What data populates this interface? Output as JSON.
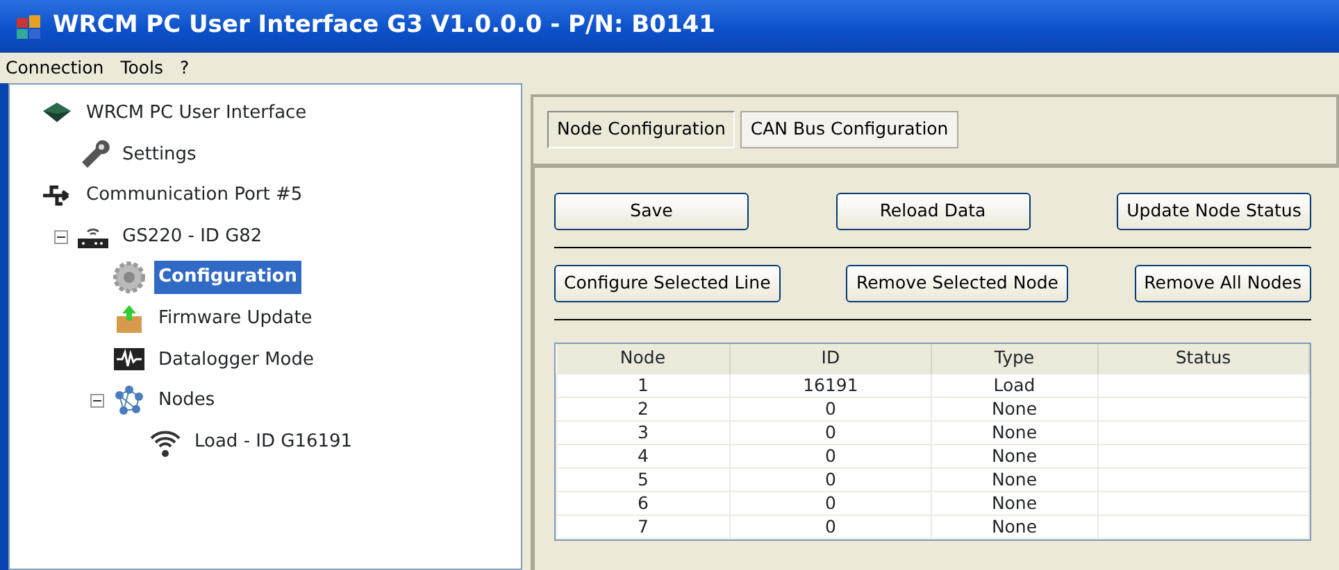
{
  "window": {
    "title": "WRCM PC User Interface G3 V1.0.0.0 - P/N: B0141"
  },
  "menu": [
    "Connection",
    "Tools",
    "?"
  ],
  "tree": [
    {
      "label": "WRCM PC User Interface",
      "kind": "app",
      "selected": false,
      "children": [
        {
          "label": "Settings",
          "kind": "settings",
          "selected": false
        }
      ]
    },
    {
      "label": "Communication Port #5",
      "kind": "port",
      "selected": false,
      "children": [
        {
          "label": "GS220 - ID G82",
          "kind": "device",
          "selected": false,
          "expanded": true,
          "children": [
            {
              "label": "Configuration",
              "kind": "config",
              "selected": true
            },
            {
              "label": "Firmware Update",
              "kind": "firmware",
              "selected": false
            },
            {
              "label": "Datalogger Mode",
              "kind": "datalogger",
              "selected": false
            },
            {
              "label": "Nodes",
              "kind": "nodes",
              "selected": false,
              "expanded": true,
              "children": [
                {
                  "label": "Load - ID G16191",
                  "kind": "sensor",
                  "selected": false
                }
              ]
            }
          ]
        }
      ]
    }
  ],
  "tabs": [
    {
      "label": "Node Configuration",
      "selected": true
    },
    {
      "label": "CAN Bus Configuration",
      "selected": false
    }
  ],
  "button_rows": [
    [
      "Save",
      "Reload Data",
      "Update Node Status"
    ],
    [
      "Configure Selected Line",
      "Remove Selected Node",
      "Remove All Nodes"
    ]
  ],
  "table": {
    "columns": [
      "Node",
      "ID",
      "Type",
      "Status"
    ],
    "rows": [
      [
        "1",
        "16191",
        "Load",
        ""
      ],
      [
        "2",
        "0",
        "None",
        ""
      ],
      [
        "3",
        "0",
        "None",
        ""
      ],
      [
        "4",
        "0",
        "None",
        ""
      ],
      [
        "5",
        "0",
        "None",
        ""
      ],
      [
        "6",
        "0",
        "None",
        ""
      ],
      [
        "7",
        "0",
        "None",
        ""
      ]
    ]
  }
}
